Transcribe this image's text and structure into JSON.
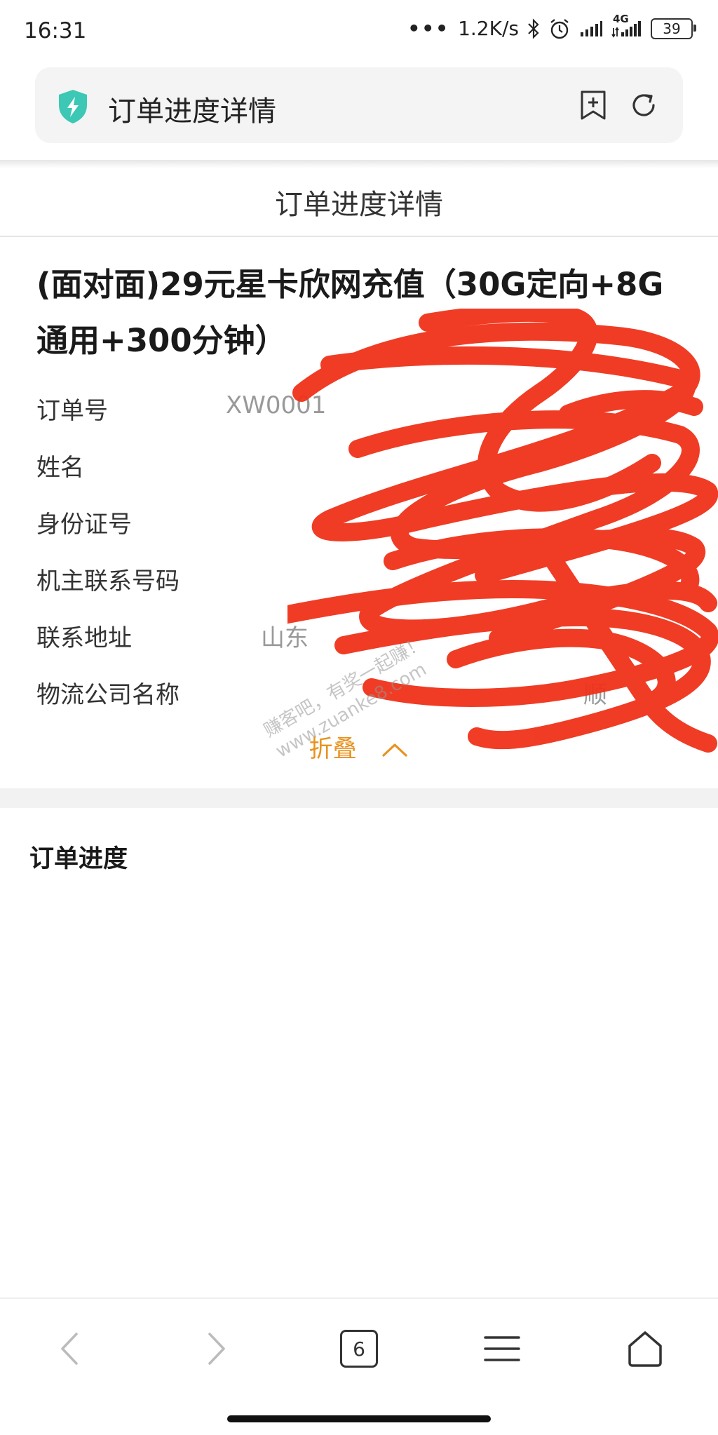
{
  "status_bar": {
    "time": "16:31",
    "network_speed": "1.2K/s",
    "network_type": "4G",
    "battery_level": "39"
  },
  "browser": {
    "address_title": "订单进度详情",
    "tab_count": "6"
  },
  "page": {
    "header_title": "订单进度详情",
    "product_title": "(面对面)29元星卡欣网充值（30G定向+8G通用+300分钟）",
    "details": [
      {
        "label": "订单号",
        "value": "XW0001"
      },
      {
        "label": "姓名",
        "value": ""
      },
      {
        "label": "身份证号",
        "value": ""
      },
      {
        "label": "机主联系号码",
        "value": ""
      },
      {
        "label": "联系地址",
        "value": "山东"
      },
      {
        "label": "物流公司名称",
        "value": "顺"
      }
    ],
    "fold_label": "折叠",
    "section_title": "订单进度"
  },
  "watermark": {
    "line1": "赚客吧，有奖一起赚！",
    "line2": "www.zuanke8.com"
  },
  "colors": {
    "accent": "#e8921e",
    "redaction": "#f0321a",
    "shield": "#3cc8b4"
  }
}
